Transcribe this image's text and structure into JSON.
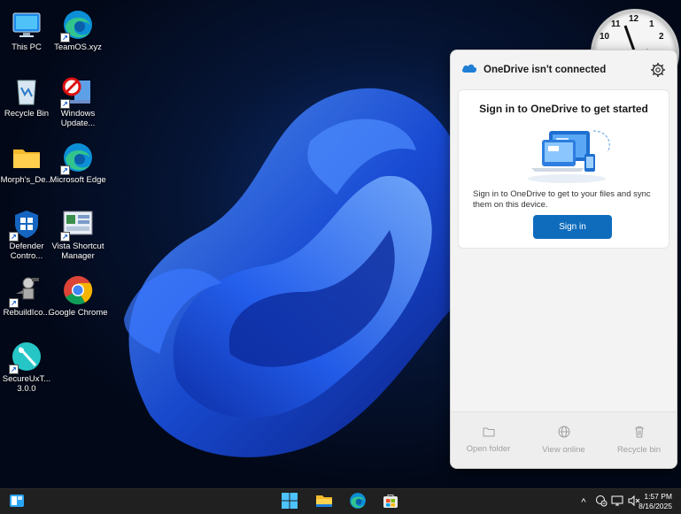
{
  "desktop": {
    "icons": [
      {
        "label": "This PC",
        "icon": "computer-icon"
      },
      {
        "label": "TeamOS.xyz",
        "icon": "edge-icon"
      },
      {
        "label": "Recycle Bin",
        "icon": "recycle-bin-icon"
      },
      {
        "label": "Windows Update...",
        "icon": "windows-update-icon"
      },
      {
        "label": "Morph's_De...",
        "icon": "folder-icon"
      },
      {
        "label": "Microsoft Edge",
        "icon": "edge-icon"
      },
      {
        "label": "Defender Contro...",
        "icon": "defender-icon"
      },
      {
        "label": "Vista Shortcut Manager",
        "icon": "shortcut-manager-icon"
      },
      {
        "label": "RebuildIco...",
        "icon": "rebuild-icon"
      },
      {
        "label": "Google Chrome",
        "icon": "chrome-icon"
      },
      {
        "label": "SecureUxT... 3.0.0",
        "icon": "secureux-icon"
      }
    ]
  },
  "clock_widget": {
    "numbers": [
      "11",
      "12",
      "1",
      "10",
      "2"
    ]
  },
  "onedrive": {
    "title": "OneDrive isn't connected",
    "heading": "Sign in to OneDrive to get started",
    "description": "Sign in to OneDrive to get to your files and sync them on this device.",
    "signin_label": "Sign in",
    "footer": [
      {
        "label": "Open folder",
        "icon": "folder-outline-icon"
      },
      {
        "label": "View online",
        "icon": "globe-icon"
      },
      {
        "label": "Recycle bin",
        "icon": "trash-icon"
      }
    ]
  },
  "taskbar": {
    "time": "1:57 PM",
    "date": "8/16/2025",
    "chevron": "^"
  },
  "colors": {
    "accent": "#0f6cbd",
    "taskbar": "#202020"
  }
}
